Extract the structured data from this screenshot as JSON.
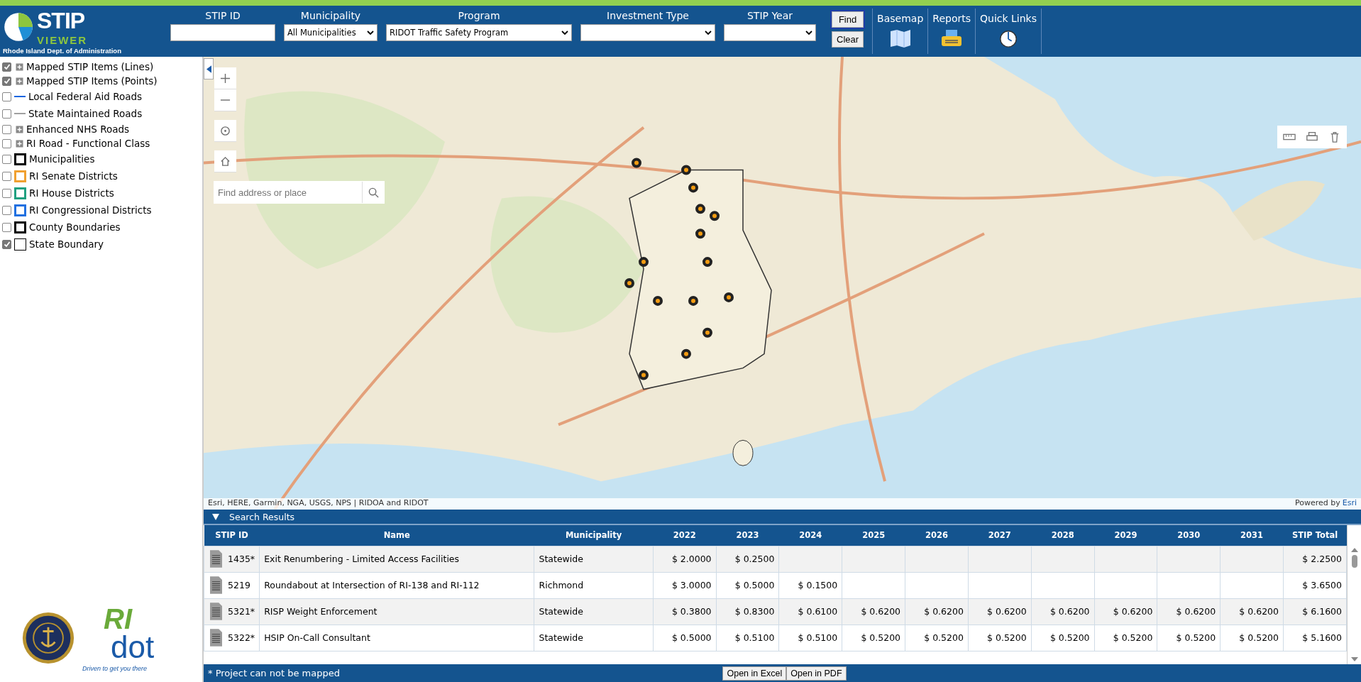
{
  "header": {
    "logo_title": "STIP",
    "logo_subtitle": "VIEWER",
    "logo_caption": "Rhode Island Dept. of Administration",
    "filters": [
      {
        "label": "STIP ID",
        "kind": "text"
      },
      {
        "label": "Municipality",
        "kind": "select",
        "value": "All Municipalities"
      },
      {
        "label": "Program",
        "kind": "select",
        "value": "RIDOT Traffic Safety Program"
      },
      {
        "label": "Investment Type",
        "kind": "select"
      },
      {
        "label": "STIP Year",
        "kind": "select"
      }
    ],
    "buttons": [
      "Find",
      "Clear"
    ],
    "tools": [
      {
        "label": "Basemap",
        "kind": "map"
      },
      {
        "label": "Reports",
        "kind": "printer"
      },
      {
        "label": "Quick Links",
        "kind": "clock"
      }
    ]
  },
  "layers": [
    {
      "label": "Mapped STIP Items (Lines)",
      "checked": true,
      "kind": "expand"
    },
    {
      "label": "Mapped STIP Items (Points)",
      "checked": true,
      "kind": "expand"
    },
    {
      "label": "Local Federal Aid Roads",
      "checked": false,
      "kind": "line",
      "color": "#1565e0"
    },
    {
      "label": "State Maintained Roads",
      "checked": false,
      "kind": "line",
      "color": "#a0a0a0"
    },
    {
      "label": "Enhanced NHS Roads",
      "checked": false,
      "kind": "expand"
    },
    {
      "label": "RI Road - Functional Class",
      "checked": false,
      "kind": "expand"
    },
    {
      "label": "Municipalities",
      "checked": false,
      "kind": "box",
      "color": "#000000"
    },
    {
      "label": "RI Senate Districts",
      "checked": false,
      "kind": "box",
      "color": "#f0a030"
    },
    {
      "label": "RI House Districts",
      "checked": false,
      "kind": "box",
      "color": "#20a080"
    },
    {
      "label": "RI Congressional Districts",
      "checked": false,
      "kind": "box",
      "color": "#2070e0"
    },
    {
      "label": "County Boundaries",
      "checked": false,
      "kind": "box",
      "color": "#000000"
    },
    {
      "label": "State Boundary",
      "checked": true,
      "kind": "thinbox",
      "color": "#000000"
    }
  ],
  "logos": {
    "ridot_mark": "RI",
    "ridot_word": "dot",
    "ridot_tagline": "Driven to get you there"
  },
  "map": {
    "search_placeholder": "Find address or place",
    "attribution": "Esri, HERE, Garmin, NGA, USGS, NPS | RIDOA and RIDOT",
    "powered_by": "Powered by",
    "powered_link": "Esri"
  },
  "results": {
    "title": "Search Results",
    "expanded": true,
    "columns": [
      "STIP ID",
      "Name",
      "Municipality",
      "2022",
      "2023",
      "2024",
      "2025",
      "2026",
      "2027",
      "2028",
      "2029",
      "2030",
      "2031",
      "STIP Total"
    ],
    "rows": [
      [
        "1435*",
        "Exit Renumbering - Limited Access Facilities",
        "Statewide",
        "$ 2.0000",
        "$ 0.2500",
        "",
        "",
        "",
        "",
        "",
        "",
        "",
        "",
        "$ 2.2500"
      ],
      [
        "5219",
        "Roundabout at Intersection of RI-138 and RI-112",
        "Richmond",
        "$ 3.0000",
        "$ 0.5000",
        "$ 0.1500",
        "",
        "",
        "",
        "",
        "",
        "",
        "",
        "$ 3.6500"
      ],
      [
        "5321*",
        "RISP Weight Enforcement",
        "Statewide",
        "$ 0.3800",
        "$ 0.8300",
        "$ 0.6100",
        "$ 0.6200",
        "$ 0.6200",
        "$ 0.6200",
        "$ 0.6200",
        "$ 0.6200",
        "$ 0.6200",
        "$ 0.6200",
        "$ 6.1600"
      ],
      [
        "5322*",
        "HSIP On-Call Consultant",
        "Statewide",
        "$ 0.5000",
        "$ 0.5100",
        "$ 0.5100",
        "$ 0.5200",
        "$ 0.5200",
        "$ 0.5200",
        "$ 0.5200",
        "$ 0.5200",
        "$ 0.5200",
        "$ 0.5200",
        "$ 5.1600"
      ]
    ],
    "footnote": "* Project can not be mapped",
    "buttons": [
      "Open in Excel",
      "Open in PDF"
    ]
  }
}
